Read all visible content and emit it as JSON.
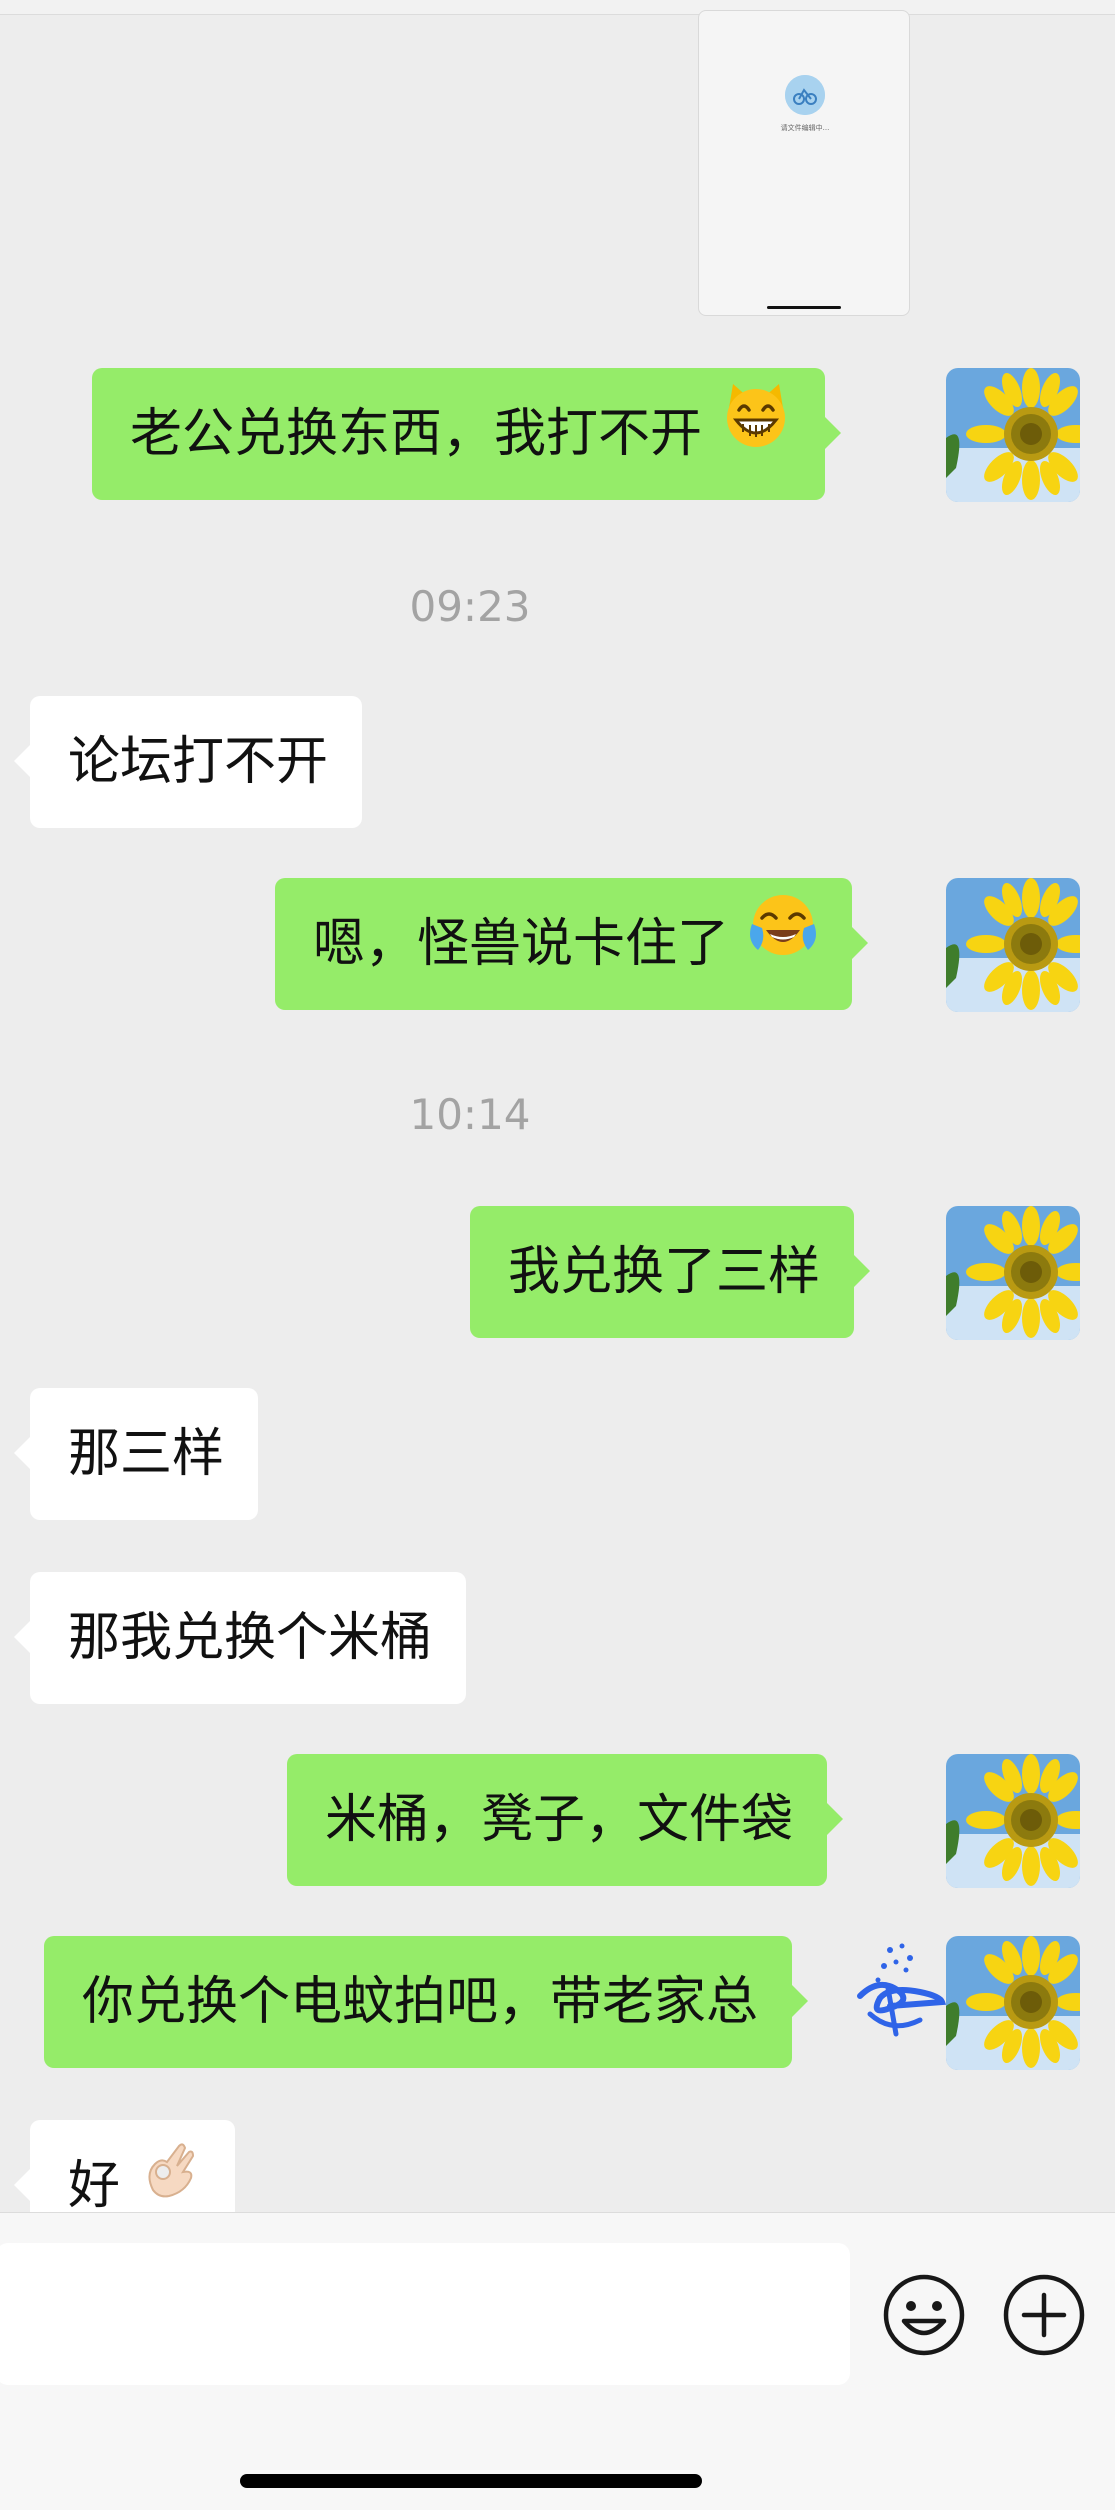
{
  "chat": {
    "card": {
      "caption": "请文件编辑中..."
    },
    "messages": [
      {
        "sender": "me",
        "text": "老公兑换东西，我打不开",
        "emoji": "grinning-cat-emoji"
      },
      {
        "type": "time",
        "text": "09:23"
      },
      {
        "sender": "other",
        "text": "论坛打不开"
      },
      {
        "sender": "me",
        "text": "嗯，怪兽说卡住了",
        "emoji": "crying-laughing-emoji"
      },
      {
        "type": "time",
        "text": "10:14"
      },
      {
        "sender": "me",
        "text": "我兑换了三样"
      },
      {
        "sender": "other",
        "text": "那三样"
      },
      {
        "sender": "other",
        "text": "那我兑换个米桶"
      },
      {
        "sender": "me",
        "text": "米桶，凳子，文件袋"
      },
      {
        "sender": "me",
        "text": "你兑换个电蚊拍吧，带老家总"
      },
      {
        "sender": "other",
        "text": "好",
        "emoji": "ok-hand-emoji"
      }
    ]
  },
  "input_bar": {
    "placeholder": "",
    "emoji_button": "smiley-face-icon",
    "more_button": "plus-circle-icon"
  },
  "colors": {
    "background": "#ededed",
    "my_bubble": "#95ec69",
    "other_bubble": "#ffffff",
    "timestamp": "#a3a3a3"
  }
}
